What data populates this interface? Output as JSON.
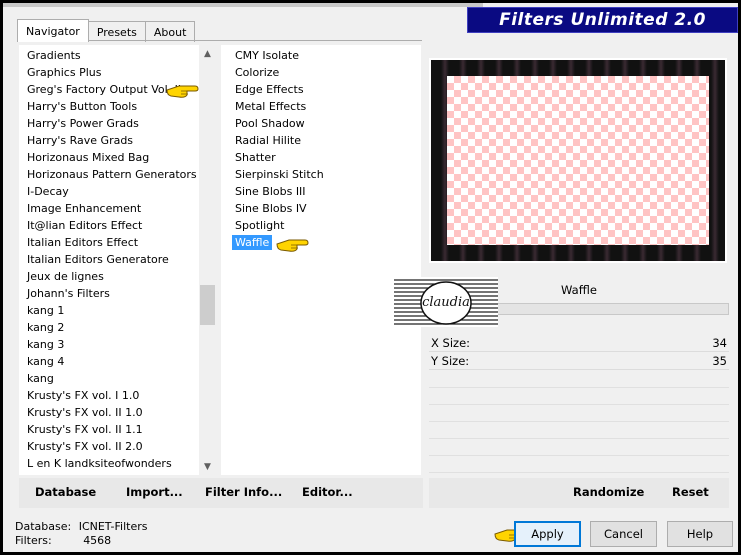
{
  "banner": {
    "title": "Filters Unlimited 2.0"
  },
  "tabs": [
    {
      "label": "Navigator"
    },
    {
      "label": "Presets"
    },
    {
      "label": "About"
    }
  ],
  "categories": [
    "Gradients",
    "Graphics Plus",
    "Greg's Factory Output Vol. II",
    "Harry's Button Tools",
    "Harry's Power Grads",
    "Harry's Rave Grads",
    "Horizonaus Mixed Bag",
    "Horizonaus Pattern Generators",
    "I-Decay",
    "Image Enhancement",
    "It@lian Editors Effect",
    "Italian Editors Effect",
    "Italian Editors Generatore",
    "Jeux de lignes",
    "Johann's Filters",
    "kang 1",
    "kang 2",
    "kang 3",
    "kang 4",
    "kang",
    "Krusty's FX vol. I 1.0",
    "Krusty's FX vol. II 1.0",
    "Krusty's FX vol. II 1.1",
    "Krusty's FX vol. II 2.0",
    "L en K landksiteofwonders"
  ],
  "filters": [
    "CMY Isolate",
    "Colorize",
    "Edge Effects",
    "Metal Effects",
    "Pool Shadow",
    "Radial Hilite",
    "Shatter",
    "Sierpinski Stitch",
    "Sine Blobs III",
    "Sine Blobs IV",
    "Spotlight",
    "Waffle"
  ],
  "left_buttons": {
    "database": "Database",
    "import": "Import...",
    "filter_info": "Filter Info...",
    "editor": "Editor..."
  },
  "selected_filter": "Waffle",
  "logo_text": "claudia",
  "params": [
    {
      "label": "X Size:",
      "value": "34"
    },
    {
      "label": "Y Size:",
      "value": "35"
    }
  ],
  "right_buttons": {
    "randomize": "Randomize",
    "reset": "Reset"
  },
  "status": {
    "database_label": "Database:",
    "database_value": "ICNET-Filters",
    "filters_label": "Filters:",
    "filters_value": "4568"
  },
  "dialog_buttons": {
    "apply": "Apply",
    "cancel": "Cancel",
    "help": "Help"
  },
  "colors": {
    "banner": "#0a0a82",
    "selection": "#3399ff",
    "checker": "#ffc4c4"
  },
  "icons": {
    "pointer": "pointing-hand-icon"
  }
}
